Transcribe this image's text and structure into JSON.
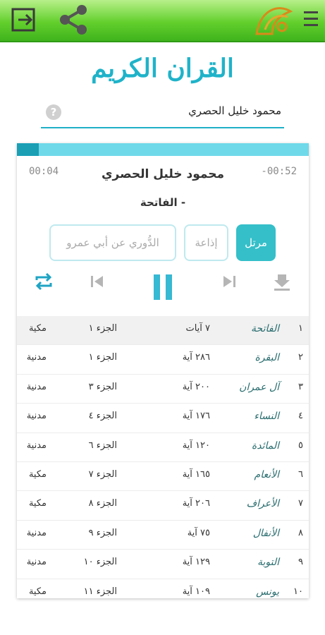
{
  "header": {
    "exit_icon": "exit-icon",
    "share_icon": "share-icon",
    "logo_icon": "quran-logo-icon",
    "menu_icon": "menu-icon",
    "brand_color": "#4cc224"
  },
  "page": {
    "title": "القران الكريم"
  },
  "reciter_select": {
    "value": "محمود خليل الحصري",
    "help": "?"
  },
  "player": {
    "elapsed": "00:04",
    "remaining": "-00:52",
    "reciter": "محمود خليل الحصري",
    "surah": "- الفاتحة",
    "progress": 0.075,
    "accent_color": "#1fb3c9"
  },
  "modes": [
    {
      "label": "مرتل",
      "active": true
    },
    {
      "label": "إذاعة",
      "active": false
    },
    {
      "label": "الدُّوري عن أبي عمرو",
      "active": false
    }
  ],
  "controls": [
    "repeat-icon",
    "previous-icon",
    "pause-icon",
    "next-icon",
    "download-icon"
  ],
  "surahs": [
    {
      "num": "١",
      "name": "الفاتحة",
      "ayat": "٧ آيات",
      "juz": "الجزء ١",
      "type": "مكية"
    },
    {
      "num": "٢",
      "name": "البقرة",
      "ayat": "٢٨٦ آية",
      "juz": "الجزء ١",
      "type": "مدنية"
    },
    {
      "num": "٣",
      "name": "آل عمران",
      "ayat": "٢٠٠ آية",
      "juz": "الجزء ٣",
      "type": "مدنية"
    },
    {
      "num": "٤",
      "name": "النساء",
      "ayat": "١٧٦ آية",
      "juz": "الجزء ٤",
      "type": "مدنية"
    },
    {
      "num": "٥",
      "name": "المائدة",
      "ayat": "١٢٠ آية",
      "juz": "الجزء ٦",
      "type": "مدنية"
    },
    {
      "num": "٦",
      "name": "الأنعام",
      "ayat": "١٦٥ آية",
      "juz": "الجزء ٧",
      "type": "مكية"
    },
    {
      "num": "٧",
      "name": "الأعراف",
      "ayat": "٢٠٦ آية",
      "juz": "الجزء ٨",
      "type": "مكية"
    },
    {
      "num": "٨",
      "name": "الأنفال",
      "ayat": "٧٥ آية",
      "juz": "الجزء ٩",
      "type": "مدنية"
    },
    {
      "num": "٩",
      "name": "التوبة",
      "ayat": "١٢٩ آية",
      "juz": "الجزء ١٠",
      "type": "مدنية"
    },
    {
      "num": "١٠",
      "name": "يونس",
      "ayat": "١٠٩ آية",
      "juz": "الجزء ١١",
      "type": "مكية"
    }
  ]
}
